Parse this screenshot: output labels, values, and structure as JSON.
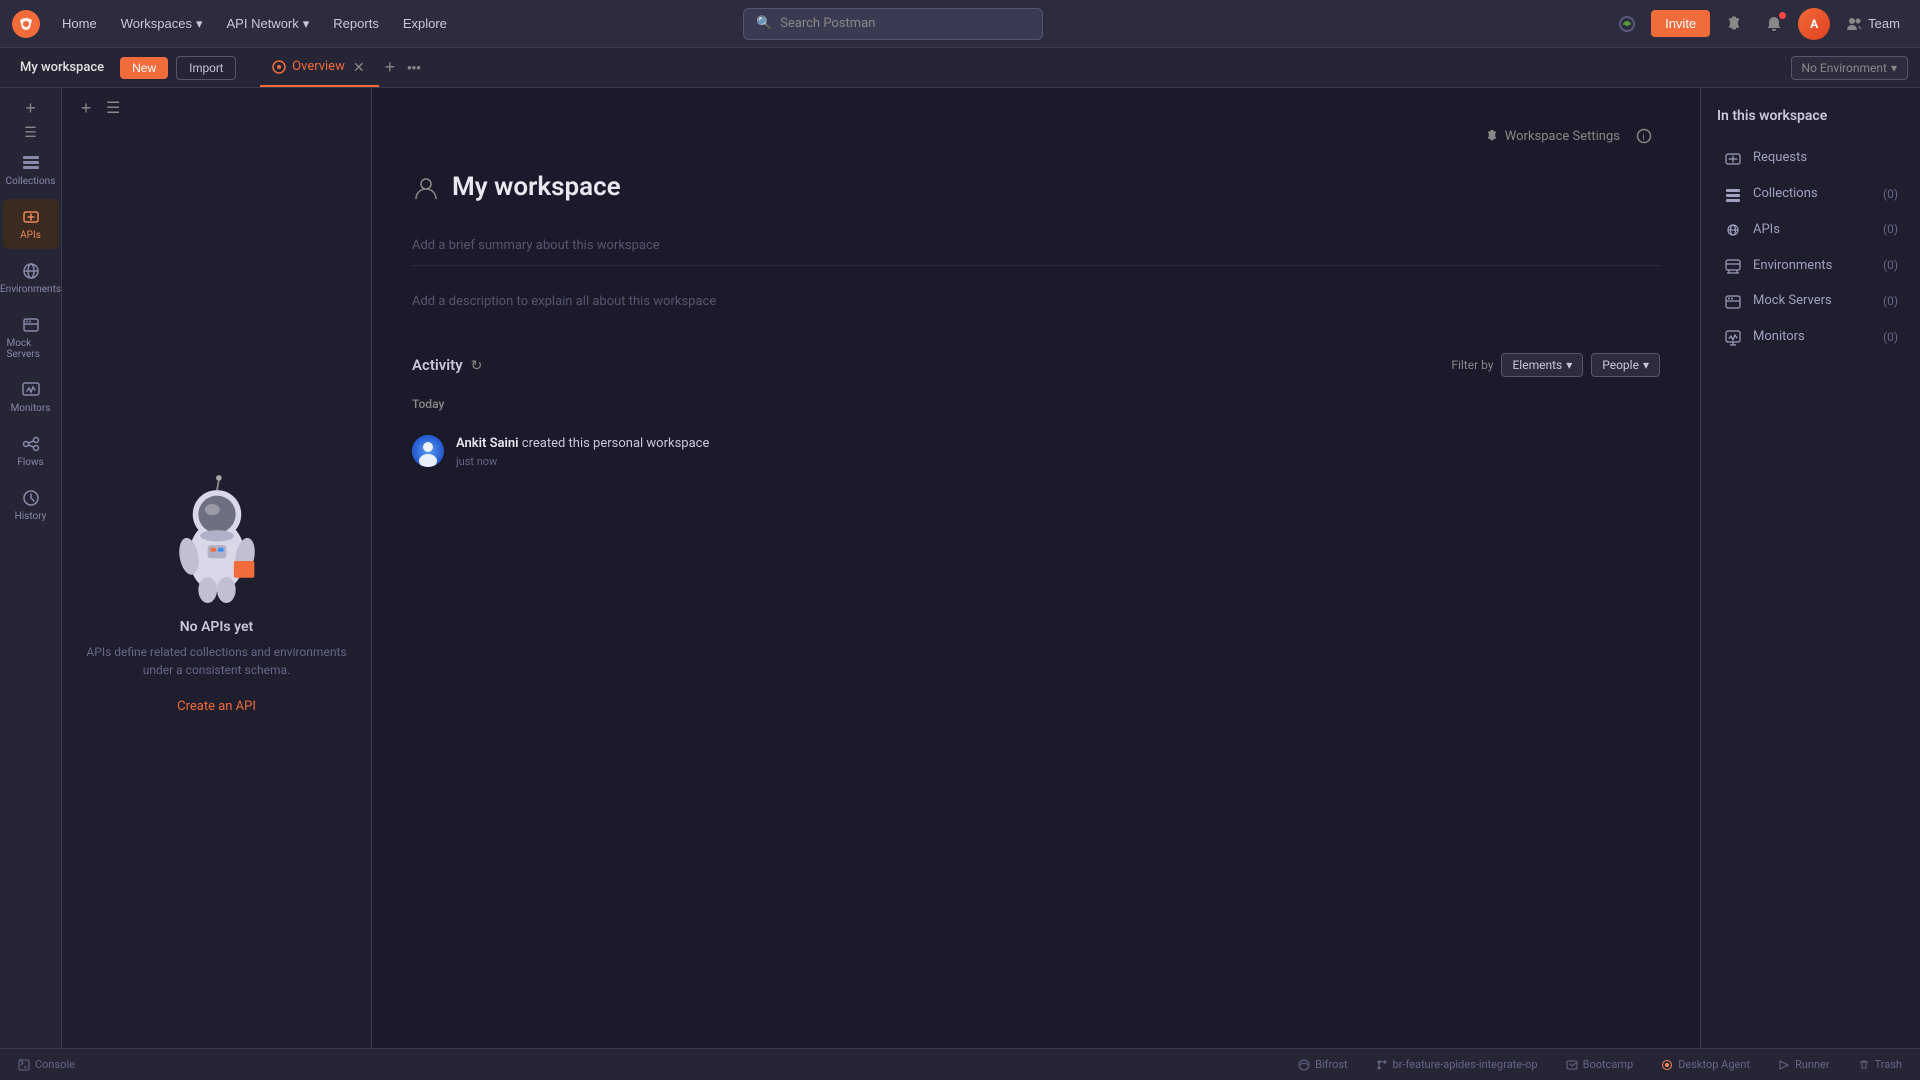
{
  "topnav": {
    "home": "Home",
    "workspaces": "Workspaces",
    "api_network": "API Network",
    "reports": "Reports",
    "explore": "Explore",
    "search_placeholder": "Search Postman",
    "invite_label": "Invite",
    "team_label": "Team"
  },
  "secondbar": {
    "workspace_name": "My workspace",
    "new_label": "New",
    "import_label": "Import",
    "tab_overview": "Overview",
    "env_placeholder": "No Environment"
  },
  "sidebar": {
    "collections_label": "Collections",
    "apis_label": "APIs",
    "environments_label": "Environments",
    "mock_servers_label": "Mock Servers",
    "monitors_label": "Monitors",
    "flows_label": "Flows",
    "history_label": "History"
  },
  "main": {
    "workspace_title": "My workspace",
    "settings_label": "Workspace Settings",
    "summary_placeholder": "Add a brief summary about this workspace",
    "desc_placeholder": "Add a description to explain all about this workspace",
    "activity_title": "Activity",
    "filter_label": "Filter by",
    "elements_label": "Elements",
    "people_label": "People",
    "today_label": "Today",
    "activity_user": "Ankit Saini",
    "activity_action": " created this personal workspace",
    "activity_time": "just now"
  },
  "right_panel": {
    "title": "In this workspace",
    "resources": [
      {
        "name": "Requests",
        "count": "",
        "icon": "requests"
      },
      {
        "name": "Collections",
        "count": "(0)",
        "icon": "collections"
      },
      {
        "name": "APIs",
        "count": "(0)",
        "icon": "apis"
      },
      {
        "name": "Environments",
        "count": "(0)",
        "icon": "environments"
      },
      {
        "name": "Mock Servers",
        "count": "(0)",
        "icon": "mock-servers"
      },
      {
        "name": "Monitors",
        "count": "(0)",
        "icon": "monitors"
      }
    ]
  },
  "left_panel": {
    "empty_title": "No APIs yet",
    "empty_desc": "APIs define related collections and\nenvironments under a consistent schema.",
    "create_label": "Create an API"
  },
  "bottombar": {
    "console_label": "Console",
    "bifrost_label": "Bifrost",
    "branch_label": "br-feature-apides-integrate-op",
    "bootcamp_label": "Bootcamp",
    "agent_label": "Desktop Agent",
    "runner_label": "Runner",
    "trash_label": "Trash"
  }
}
